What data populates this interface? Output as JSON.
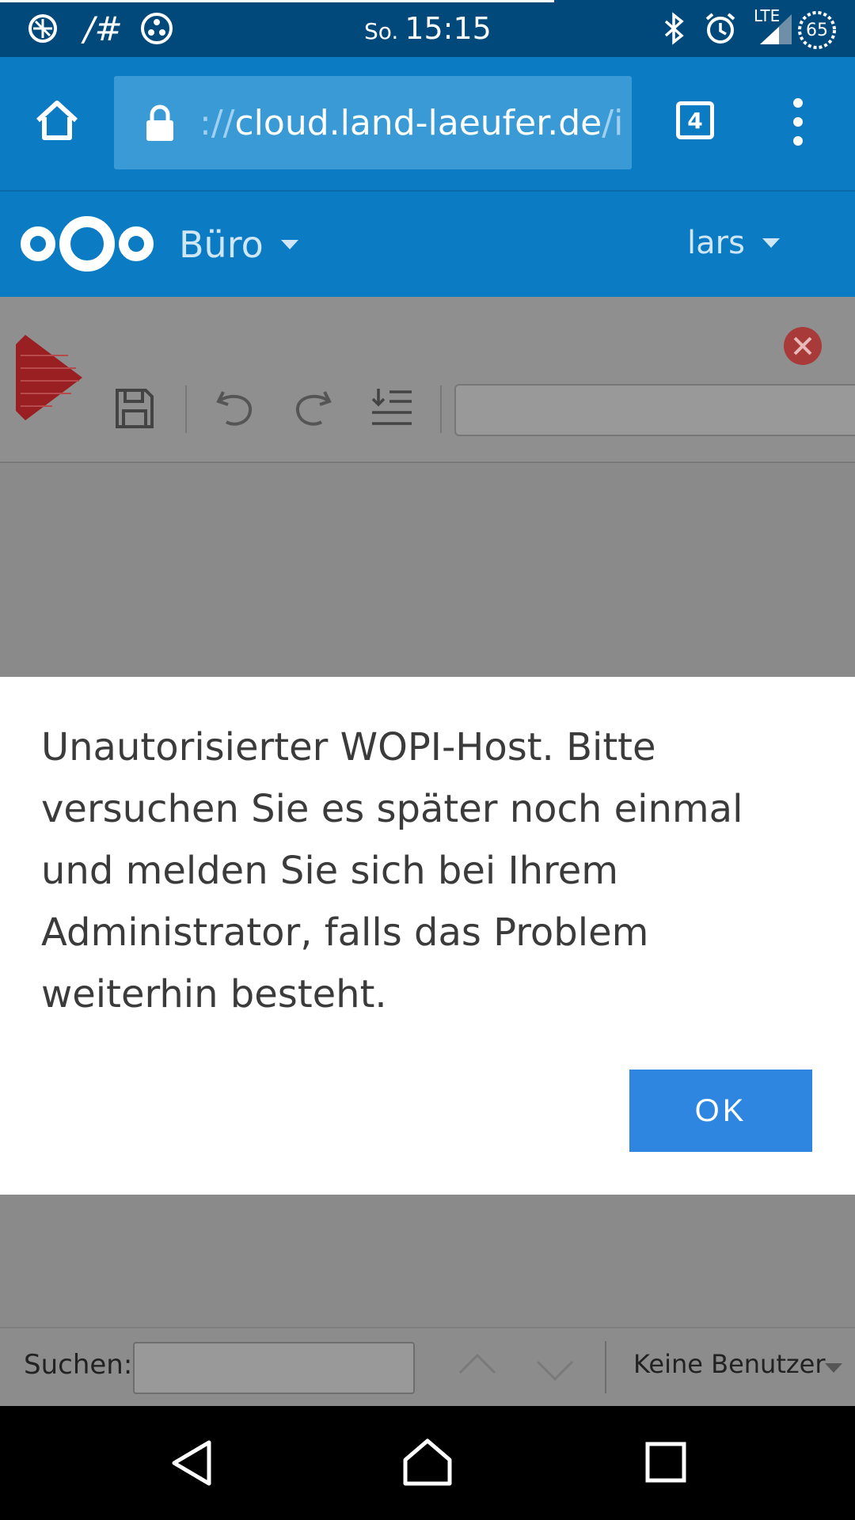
{
  "status_bar": {
    "left_icons": [
      "app-icon",
      "hash-icon",
      "dots-app-icon"
    ],
    "hash_text": "/#",
    "day": "So.",
    "time": "15:15",
    "right_icons": [
      "bluetooth-icon",
      "alarm-icon",
      "signal-icon",
      "battery-icon"
    ],
    "network": "LTE",
    "battery": "65"
  },
  "browser": {
    "url_scheme": "://",
    "url_host": "cloud.land-laeufer.de",
    "url_rest": "/i",
    "tab_count": "4",
    "colors": {
      "toolbar": "#0b7bc4",
      "urlbox": "#3a9ad6"
    }
  },
  "nextcloud": {
    "app_menu": "Büro",
    "user_menu": "lars"
  },
  "dialog": {
    "message": "Unautorisierter WOPI-Host. Bitte versuchen Sie es später noch einmal und melden Sie sich bei Ihrem Administrator, falls das Problem weiterhin besteht.",
    "ok_label": "OK",
    "colors": {
      "ok_button": "#2f86e0"
    }
  },
  "search_bar": {
    "label": "Suchen:",
    "input_value": "",
    "users_select": "Keine Benutzer"
  }
}
